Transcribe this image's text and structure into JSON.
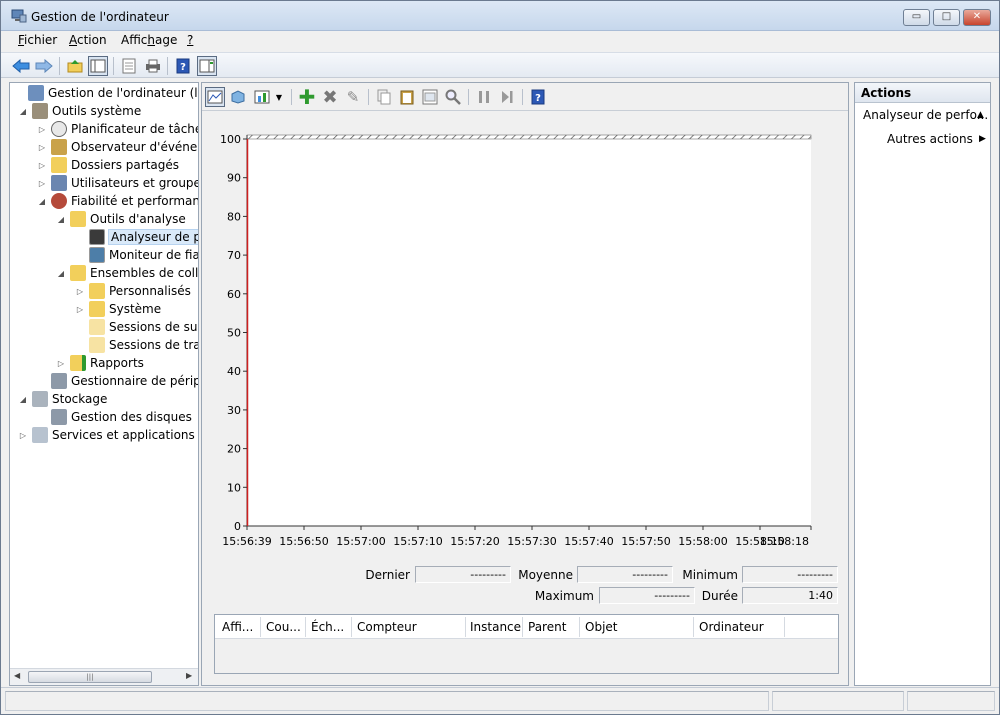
{
  "window": {
    "title": "Gestion de l'ordinateur",
    "minimize_glyph": "▭",
    "maximize_glyph": "□",
    "close_glyph": "✕"
  },
  "menu": [
    {
      "prefix": "",
      "underlined": "F",
      "rest": "ichier"
    },
    {
      "prefix": "",
      "underlined": "A",
      "rest": "ction"
    },
    {
      "prefix": "Affic",
      "underlined": "h",
      "rest": "age"
    },
    {
      "prefix": "",
      "underlined": "?",
      "rest": ""
    }
  ],
  "toolbar_icons": [
    "back-arrow-icon",
    "forward-arrow-icon",
    "up-folder-icon",
    "show-tree-icon",
    "properties-icon",
    "print-icon",
    "help-icon",
    "show-action-pane-icon"
  ],
  "tree": {
    "root": "Gestion de l'ordinateur (local)",
    "system_tools": "Outils système",
    "task_scheduler": "Planificateur de tâches",
    "event_viewer": "Observateur d'événeme",
    "shared_folders": "Dossiers partagés",
    "users_groups": "Utilisateurs et groupes l",
    "reliability": "Fiabilité et performance",
    "analysis_tools": "Outils d'analyse",
    "perf_analyzer": "Analyseur de per",
    "reliability_monitor": "Moniteur de fiab",
    "collector_sets": "Ensembles de collec",
    "custom": "Personnalisés",
    "system": "Système",
    "trace_sessions": "Sessions de suivi",
    "trace_sessions_startup": "Sessions de trace",
    "reports": "Rapports",
    "device_manager": "Gestionnaire de périphé",
    "storage": "Stockage",
    "disk_management": "Gestion des disques",
    "services_apps": "Services et applications"
  },
  "chart_data": {
    "type": "line",
    "title": "",
    "xlabel": "",
    "ylabel": "",
    "ylim": [
      0,
      100
    ],
    "y_ticks": [
      "0",
      "10",
      "20",
      "30",
      "40",
      "50",
      "60",
      "70",
      "80",
      "90",
      "100"
    ],
    "x_ticks": [
      "15:56:39",
      "15:56:50",
      "15:57:00",
      "15:57:10",
      "15:57:20",
      "15:57:30",
      "15:57:40",
      "15:57:50",
      "15:58:00",
      "15:58:10",
      "15:58:18"
    ],
    "series": [],
    "grid": false
  },
  "stats": {
    "last_label": "Dernier",
    "last_value": "---------",
    "average_label": "Moyenne",
    "average_value": "---------",
    "minimum_label": "Minimum",
    "minimum_value": "---------",
    "maximum_label": "Maximum",
    "maximum_value": "---------",
    "duration_label": "Durée",
    "duration_value": "1:40"
  },
  "counter_columns": [
    "Affi...",
    "Cou...",
    "Éch...",
    "Compteur",
    "Instance",
    "Parent",
    "Objet",
    "Ordinateur"
  ],
  "actions": {
    "title": "Actions",
    "section": "Analyseur de perfo...",
    "more": "Autres actions"
  }
}
